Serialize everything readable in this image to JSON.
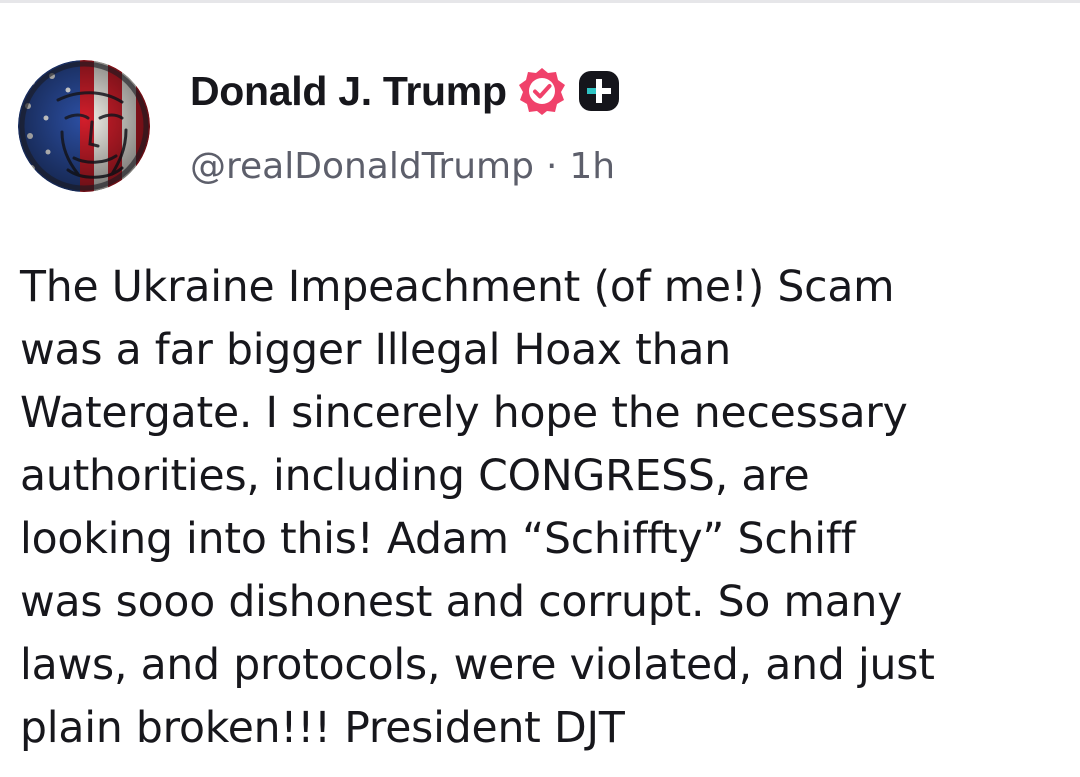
{
  "author": {
    "display_name": "Donald J. Trump",
    "handle": "@realDonaldTrump",
    "separator": "·",
    "time_ago": "1h",
    "avatar_icon": "avatar-flag-portrait-icon",
    "badges": [
      {
        "icon": "verified-badge-icon",
        "color": "#f0416a"
      },
      {
        "icon": "plus-badge-icon",
        "color": "#15151b"
      }
    ]
  },
  "post": {
    "lines": [
      "The Ukraine Impeachment (of me!) Scam",
      "was a far bigger Illegal Hoax than",
      "Watergate. I sincerely hope the necessary",
      "authorities, including CONGRESS, are",
      "looking into this! Adam “Schiffty” Schiff",
      "was sooo dishonest and corrupt. So many",
      "laws, and protocols, were violated, and just",
      "plain broken!!! President DJT"
    ]
  },
  "colors": {
    "text_primary": "#17171c",
    "text_secondary": "#5d5f6b",
    "verified": "#f0416a",
    "background": "#ffffff"
  }
}
